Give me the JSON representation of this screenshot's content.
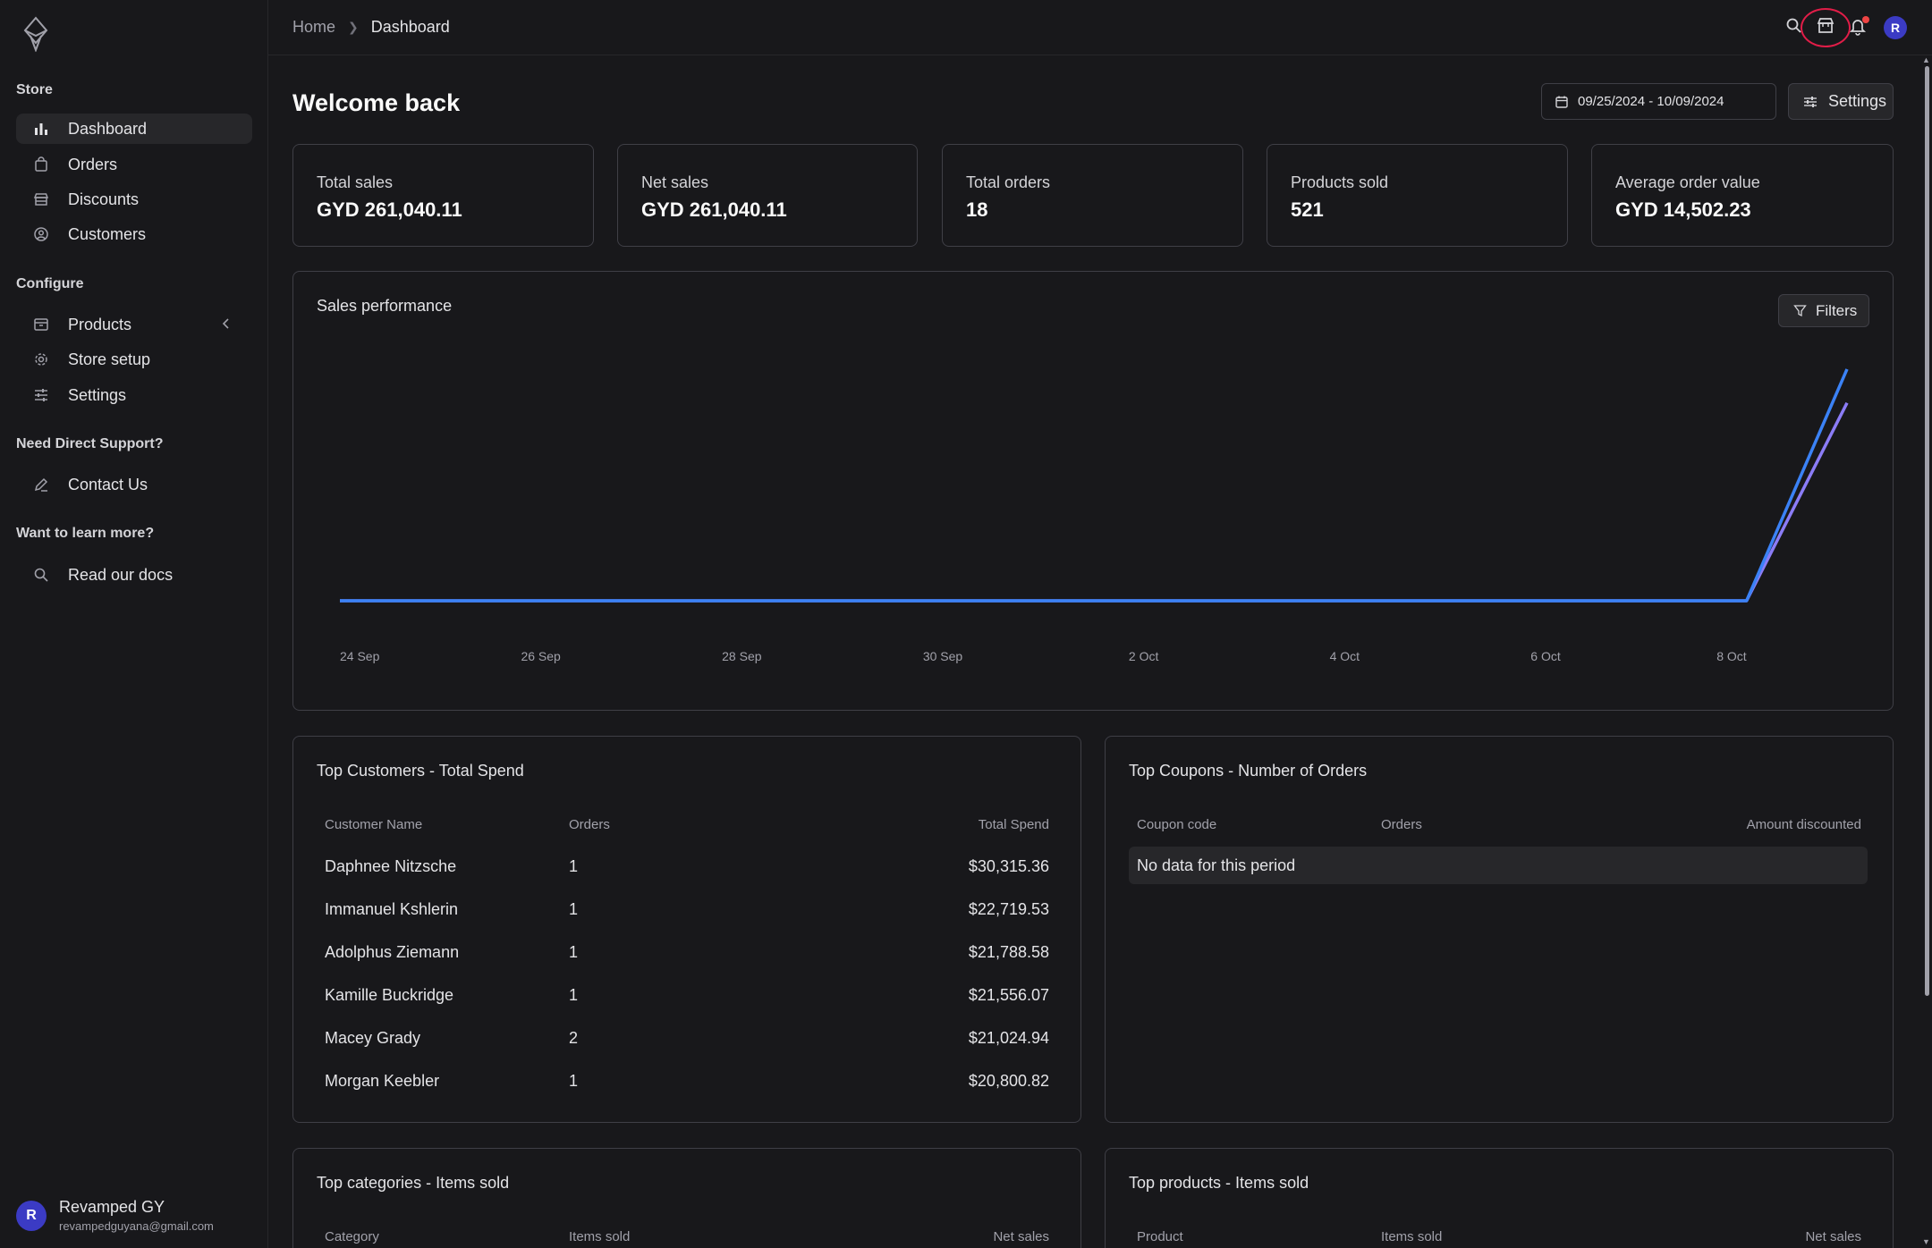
{
  "sidebar": {
    "sections": {
      "store": "Store",
      "configure": "Configure",
      "support": "Need Direct Support?",
      "learn": "Want to learn more?"
    },
    "items": {
      "dashboard": "Dashboard",
      "orders": "Orders",
      "discounts": "Discounts",
      "customers": "Customers",
      "products": "Products",
      "store_setup": "Store setup",
      "settings": "Settings",
      "contact": "Contact Us",
      "docs": "Read our docs"
    },
    "user": {
      "initial": "R",
      "name": "Revamped GY",
      "email": "revampedguyana@gmail.com"
    }
  },
  "header": {
    "breadcrumb_home": "Home",
    "breadcrumb_current": "Dashboard",
    "avatar_initial": "R"
  },
  "main": {
    "title": "Welcome back",
    "date_range": "09/25/2024 - 10/09/2024",
    "settings_label": "Settings",
    "stats": [
      {
        "label": "Total sales",
        "value": "GYD 261,040.11"
      },
      {
        "label": "Net sales",
        "value": "GYD 261,040.11"
      },
      {
        "label": "Total orders",
        "value": "18"
      },
      {
        "label": "Products sold",
        "value": "521"
      },
      {
        "label": "Average order value",
        "value": "GYD 14,502.23"
      }
    ],
    "sales": {
      "title": "Sales performance",
      "filters_label": "Filters"
    },
    "top_customers": {
      "title": "Top Customers - Total Spend",
      "headers": [
        "Customer Name",
        "Orders",
        "Total Spend"
      ],
      "rows": [
        [
          "Daphnee Nitzsche",
          "1",
          "$30,315.36"
        ],
        [
          "Immanuel Kshlerin",
          "1",
          "$22,719.53"
        ],
        [
          "Adolphus Ziemann",
          "1",
          "$21,788.58"
        ],
        [
          "Kamille Buckridge",
          "1",
          "$21,556.07"
        ],
        [
          "Macey Grady",
          "2",
          "$21,024.94"
        ],
        [
          "Morgan Keebler",
          "1",
          "$20,800.82"
        ]
      ]
    },
    "top_coupons": {
      "title": "Top Coupons - Number of Orders",
      "headers": [
        "Coupon code",
        "Orders",
        "Amount discounted"
      ],
      "empty": "No data for this period"
    },
    "top_categories": {
      "title": "Top categories - Items sold",
      "headers": [
        "Category",
        "Items sold",
        "Net sales"
      ]
    },
    "top_products": {
      "title": "Top products - Items sold",
      "headers": [
        "Product",
        "Items sold",
        "Net sales"
      ]
    }
  },
  "chart_data": {
    "type": "line",
    "x": [
      "24 Sep",
      "25 Sep",
      "26 Sep",
      "27 Sep",
      "28 Sep",
      "29 Sep",
      "30 Sep",
      "1 Oct",
      "2 Oct",
      "3 Oct",
      "4 Oct",
      "5 Oct",
      "6 Oct",
      "7 Oct",
      "8 Oct",
      "9 Oct"
    ],
    "x_tick_labels": [
      "24 Sep",
      "26 Sep",
      "28 Sep",
      "30 Sep",
      "2 Oct",
      "4 Oct",
      "6 Oct",
      "8 Oct"
    ],
    "series": [
      {
        "color": "#3b82f6",
        "values": [
          0,
          0,
          0,
          0,
          0,
          0,
          0,
          0,
          0,
          0,
          0,
          0,
          0,
          -3,
          0,
          261040
        ]
      },
      {
        "color": "#8b7cf6",
        "values": [
          0,
          0,
          0,
          0,
          0,
          0,
          0,
          0,
          0,
          0,
          0,
          0,
          0,
          0,
          0,
          223000
        ]
      }
    ],
    "ylim": [
      -3000,
      270000
    ],
    "grid": false
  }
}
